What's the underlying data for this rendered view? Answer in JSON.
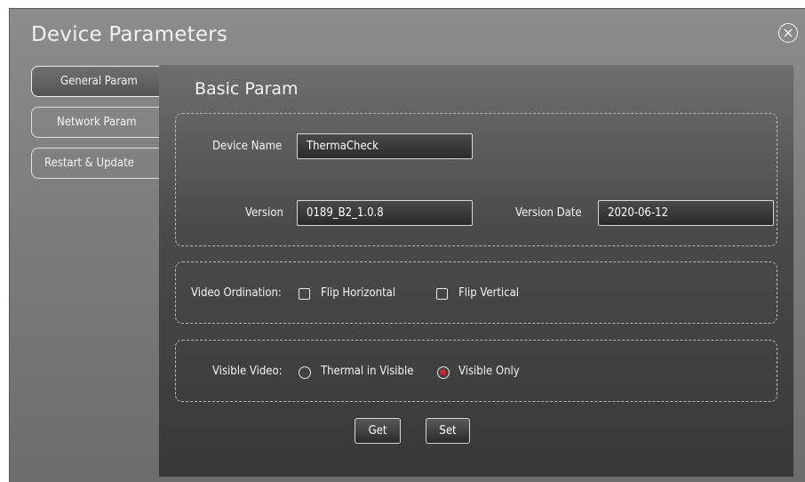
{
  "dialog": {
    "title": "Device Parameters",
    "close_icon": "close-circle-icon"
  },
  "tabs": [
    {
      "label": "General Param",
      "active": true
    },
    {
      "label": "Network Param",
      "active": false
    },
    {
      "label": "Restart & Update",
      "active": false
    }
  ],
  "panel": {
    "title": "Basic Param",
    "device_name_label": "Device Name",
    "device_name_value": "ThermaCheck",
    "version_label": "Version",
    "version_value": "0189_B2_1.0.8",
    "version_date_label": "Version Date",
    "version_date_value": "2020-06-12",
    "video_ordination_label": "Video Ordination:",
    "flip_horizontal_label": "Flip Horizontal",
    "flip_horizontal_checked": false,
    "flip_vertical_label": "Flip Vertical",
    "flip_vertical_checked": false,
    "visible_video_label": "Visible Video:",
    "thermal_in_visible_label": "Thermal in Visible",
    "visible_only_label": "Visible Only",
    "visible_video_selected": "Visible Only",
    "get_label": "Get",
    "set_label": "Set"
  },
  "colors": {
    "radio_selected": "#d8232a"
  }
}
